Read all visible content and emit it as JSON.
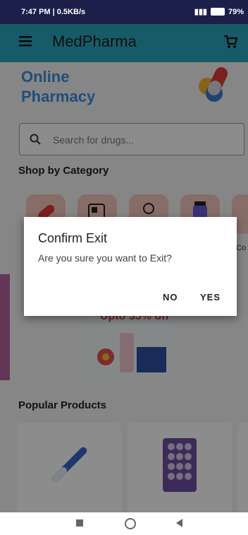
{
  "status": {
    "time": "7:47 PM | 0.5KB/s",
    "battery": "79%"
  },
  "appbar": {
    "title": "MedPharma"
  },
  "hero": {
    "line1": "Online",
    "line2": "Pharmacy"
  },
  "search": {
    "placeholder": "Search for drugs..."
  },
  "sections": {
    "shop_by_category": "Shop by Category",
    "popular_products": "Popular Products"
  },
  "category_label_partial": "Co",
  "promo": {
    "discount": "Upto 35% off"
  },
  "dialog": {
    "title": "Confirm Exit",
    "message": "Are you sure you want to Exit?",
    "no": "NO",
    "yes": "YES"
  },
  "colors": {
    "appbar": "#2ba6bd",
    "status": "#1b1f4a",
    "accent": "#3b8ee0"
  }
}
